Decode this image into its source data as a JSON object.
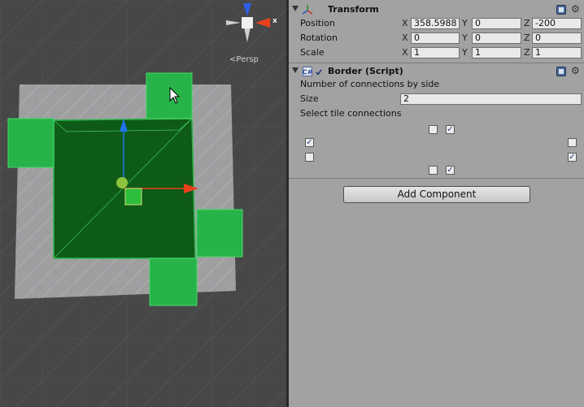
{
  "scene_view": {
    "gizmo_axis_x": "x",
    "persp_label": "Persp",
    "colors": {
      "tile_green": "#27b34a",
      "selected_dark": "#0e5a17",
      "grid_gray": "#9d9d9d",
      "x_axis": "#e8401c",
      "y_axis": "#1f74e8"
    }
  },
  "transform": {
    "title": "Transform",
    "position": {
      "label": "Position",
      "x": "358.5988",
      "y": "0",
      "z": "-200"
    },
    "rotation": {
      "label": "Rotation",
      "x": "0",
      "y": "0",
      "z": "0"
    },
    "scale": {
      "label": "Scale",
      "x": "1",
      "y": "1",
      "z": "1"
    },
    "axis_labels": {
      "x": "X",
      "y": "Y",
      "z": "Z"
    }
  },
  "border_script": {
    "title": "Border (Script)",
    "connections_label": "Number of connections by side",
    "size_label": "Size",
    "size_value": "2",
    "select_label": "Select tile connections",
    "top": [
      false,
      true
    ],
    "left": [
      true,
      false
    ],
    "right": [
      false,
      true
    ],
    "bottom": [
      false,
      true
    ]
  },
  "add_component_label": "Add Component"
}
